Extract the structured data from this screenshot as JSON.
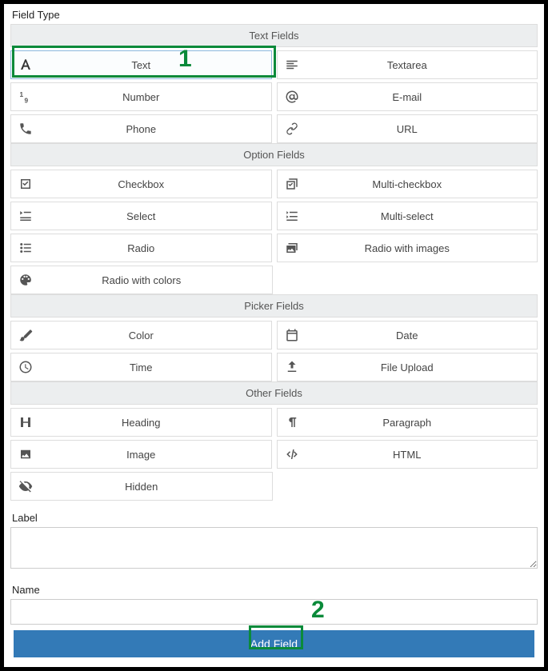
{
  "title": "Field Type",
  "groups": [
    {
      "header": "Text Fields",
      "rows": [
        [
          {
            "id": "text",
            "label": "Text",
            "icon": "letter-a",
            "selected": true
          },
          {
            "id": "textarea",
            "label": "Textarea",
            "icon": "align-left"
          }
        ],
        [
          {
            "id": "number",
            "label": "Number",
            "icon": "one-nine"
          },
          {
            "id": "email",
            "label": "E-mail",
            "icon": "at"
          }
        ],
        [
          {
            "id": "phone",
            "label": "Phone",
            "icon": "phone"
          },
          {
            "id": "url",
            "label": "URL",
            "icon": "link"
          }
        ]
      ]
    },
    {
      "header": "Option Fields",
      "rows": [
        [
          {
            "id": "checkbox",
            "label": "Checkbox",
            "icon": "check-square"
          },
          {
            "id": "multi-checkbox",
            "label": "Multi-checkbox",
            "icon": "multi-check-square"
          }
        ],
        [
          {
            "id": "select",
            "label": "Select",
            "icon": "list-caret"
          },
          {
            "id": "multi-select",
            "label": "Multi-select",
            "icon": "multi-list-caret"
          }
        ],
        [
          {
            "id": "radio",
            "label": "Radio",
            "icon": "radio-list"
          },
          {
            "id": "radio-images",
            "label": "Radio with images",
            "icon": "image-stack"
          }
        ],
        [
          {
            "id": "radio-colors",
            "label": "Radio with colors",
            "icon": "palette"
          },
          null
        ]
      ]
    },
    {
      "header": "Picker Fields",
      "rows": [
        [
          {
            "id": "color",
            "label": "Color",
            "icon": "brush"
          },
          {
            "id": "date",
            "label": "Date",
            "icon": "calendar"
          }
        ],
        [
          {
            "id": "time",
            "label": "Time",
            "icon": "clock"
          },
          {
            "id": "file",
            "label": "File Upload",
            "icon": "upload"
          }
        ]
      ]
    },
    {
      "header": "Other Fields",
      "rows": [
        [
          {
            "id": "heading",
            "label": "Heading",
            "icon": "heading"
          },
          {
            "id": "paragraph",
            "label": "Paragraph",
            "icon": "pilcrow"
          }
        ],
        [
          {
            "id": "image",
            "label": "Image",
            "icon": "image"
          },
          {
            "id": "html",
            "label": "HTML",
            "icon": "code"
          }
        ],
        [
          {
            "id": "hidden",
            "label": "Hidden",
            "icon": "eye-off"
          },
          null
        ]
      ]
    }
  ],
  "labelField": {
    "label": "Label",
    "value": ""
  },
  "nameField": {
    "label": "Name",
    "value": ""
  },
  "submit": "Add Field",
  "annotations": {
    "one": "1",
    "two": "2"
  }
}
